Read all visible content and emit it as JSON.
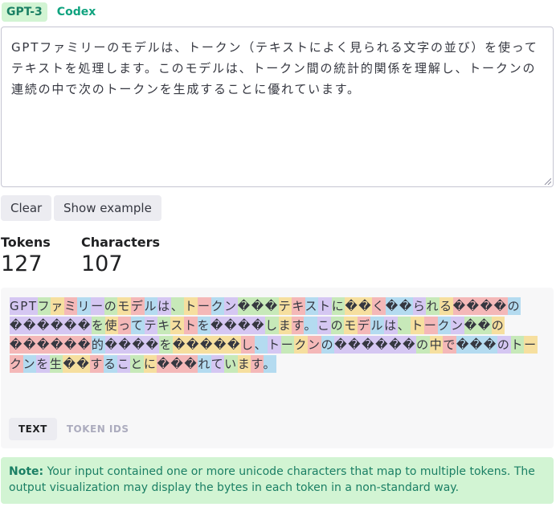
{
  "tabs": [
    {
      "label": "GPT-3",
      "active": true
    },
    {
      "label": "Codex",
      "active": false
    }
  ],
  "input_text": "GPTファミリーのモデルは、トークン（テキストによく見られる文字の並び）を使ってテキストを処理します。このモデルは、トークン間の統計的関係を理解し、トークンの連続の中で次のトークンを生成することに優れています。",
  "buttons": {
    "clear": "Clear",
    "show_example": "Show example"
  },
  "stats": {
    "tokens_label": "Tokens",
    "tokens_value": "127",
    "characters_label": "Characters",
    "characters_value": "107"
  },
  "token_colors": [
    "#d5c7f2",
    "#c7e9b9",
    "#f6df9f",
    "#f4b8b8",
    "#b4dbf0"
  ],
  "tokens": [
    "GPT",
    "フ",
    "ァ",
    "ミ",
    "リ",
    "ー",
    "の",
    "モ",
    "デ",
    "ル",
    "は",
    "、",
    "ト",
    "ー",
    "ク",
    "ン",
    "���",
    "テ",
    "キ",
    "ス",
    "ト",
    "に",
    "��",
    "く",
    "��",
    "ら",
    "れ",
    "る",
    "����",
    "の",
    "������",
    "を",
    "使",
    "っ",
    "て",
    "テ",
    "キ",
    "ス",
    "ト",
    "を",
    "����",
    "し",
    "ま",
    "す",
    "。",
    "こ",
    "の",
    "モ",
    "デ",
    "ル",
    "は",
    "、",
    "ト",
    "ー",
    "ク",
    "ン",
    "��",
    "の",
    "������",
    "的",
    "����",
    "を",
    "�����",
    "し",
    "、",
    "ト",
    "ー",
    "ク",
    "ン",
    "の",
    "������",
    "の",
    "中",
    "で",
    "���",
    "の",
    "ト",
    "ー",
    "ク",
    "ン",
    "を",
    "生",
    "��",
    "す",
    "る",
    "こ",
    "と",
    "に",
    "���",
    "れ",
    "て",
    "い",
    "ま",
    "す",
    "。"
  ],
  "view_tabs": [
    {
      "label": "TEXT",
      "active": true
    },
    {
      "label": "TOKEN IDS",
      "active": false
    }
  ],
  "note": {
    "label": "Note:",
    "text": " Your input contained one or more unicode characters that map to multiple tokens. The output visualization may display the bytes in each token in a non-standard way."
  }
}
